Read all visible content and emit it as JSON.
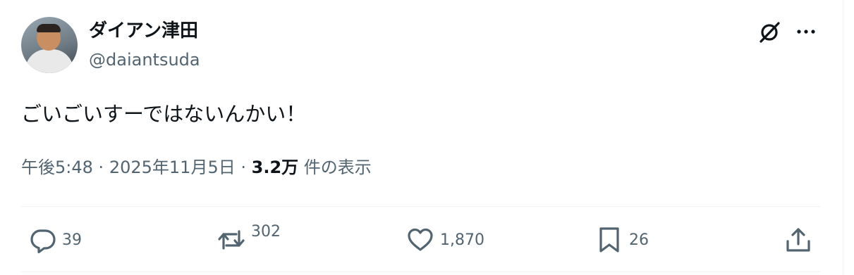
{
  "author": {
    "display_name": "ダイアン津田",
    "handle": "@daiantsuda"
  },
  "tweet": {
    "text": "ごいごいすーではないんかい！"
  },
  "meta": {
    "time": "午後5:48",
    "sep1": "·",
    "date": "2025年11月5日",
    "sep2": "·",
    "views_count": "3.2万",
    "views_label": "件の表示"
  },
  "actions": {
    "replies": "39",
    "reposts": "302",
    "likes": "1,870",
    "bookmarks": "26"
  },
  "icons": {
    "grok": "grok-icon",
    "more": "more-icon",
    "reply": "reply-icon",
    "repost": "repost-icon",
    "like": "heart-icon",
    "bookmark": "bookmark-icon",
    "share": "share-icon"
  },
  "colors": {
    "text": "#0f1419",
    "secondary": "#536471",
    "divider": "#eff3f4"
  }
}
